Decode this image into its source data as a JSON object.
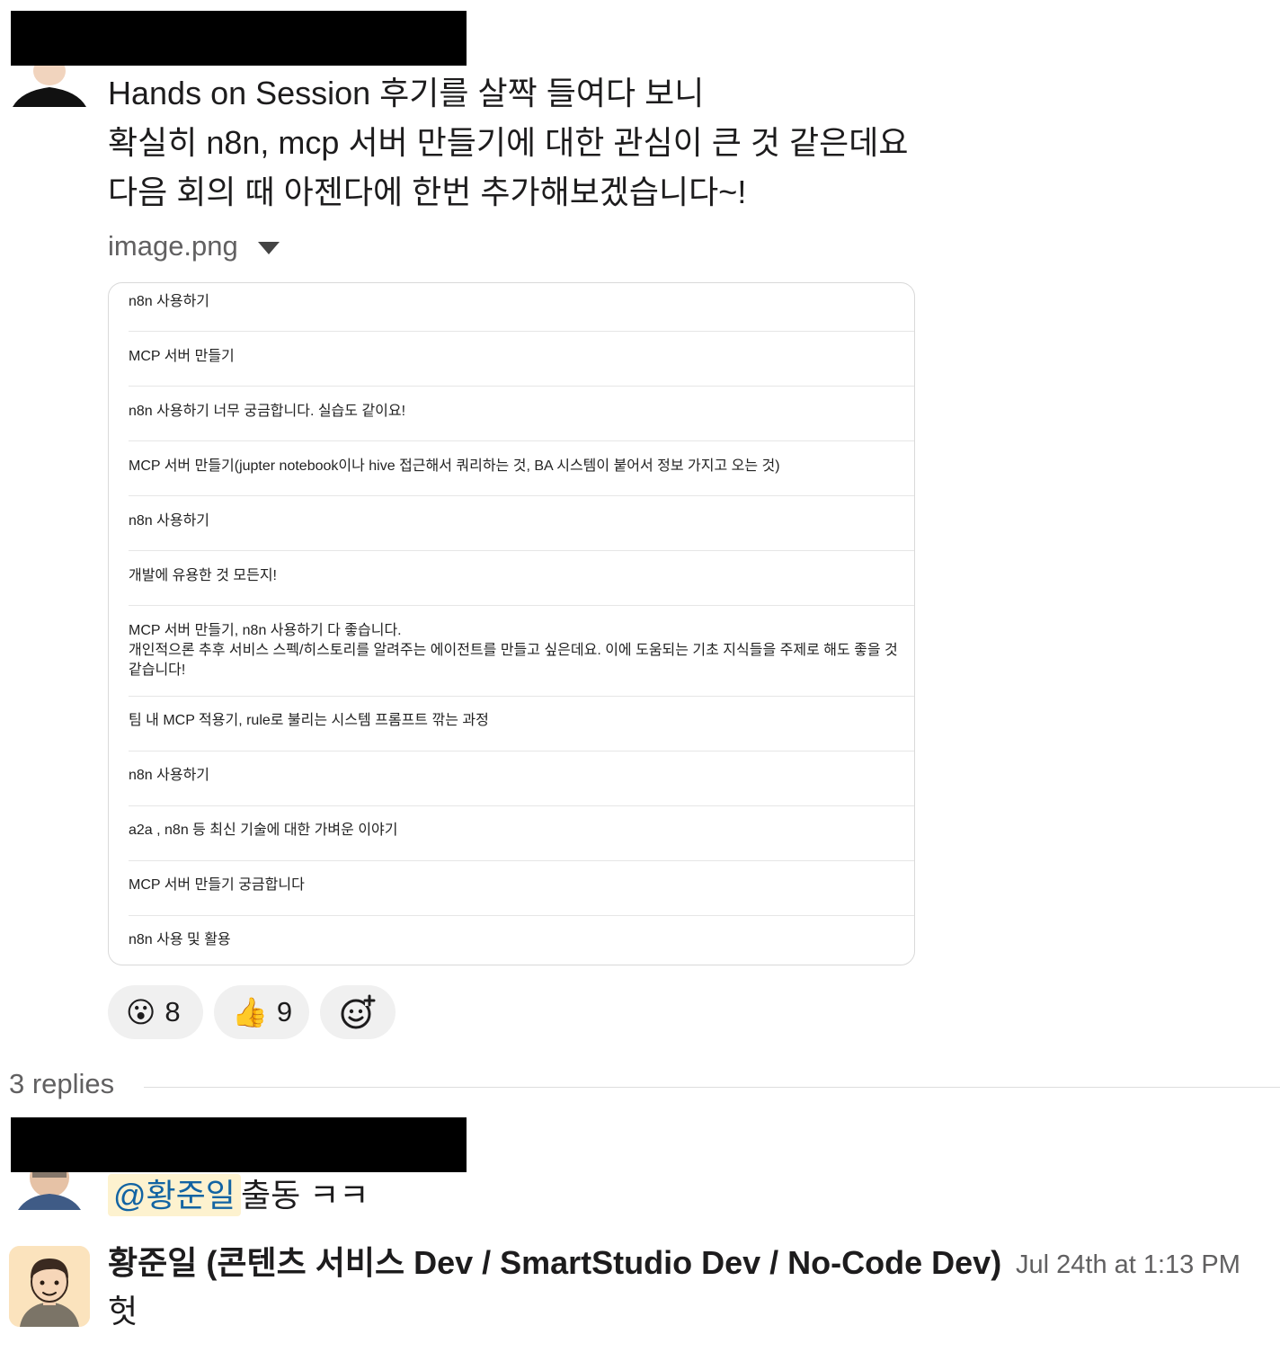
{
  "message": {
    "lines": [
      "Hands on Session 후기를 살짝 들여다 보니",
      "확실히 n8n, mcp 서버 만들기에 대한 관심이 큰 것 같은데요",
      "다음 회의 때 아젠다에 한번 추가해보겠습니다~!"
    ],
    "attachment_name": "image.png",
    "attachment_rows": [
      "n8n 사용하기",
      "MCP 서버 만들기",
      "n8n 사용하기 너무 궁금합니다. 실습도 같이요!",
      "MCP 서버 만들기(jupter notebook이나 hive 접근해서 쿼리하는 것, BA 시스템이 붙어서 정보 가지고 오는 것)",
      "n8n 사용하기",
      "개발에 유용한 것 모든지!",
      "MCP 서버 만들기, n8n 사용하기 다 좋습니다.\n개인적으론 추후 서비스 스펙/히스토리를 알려주는 에이전트를 만들고 싶은데요. 이에 도움되는 기초 지식들을 주제로 해도 좋을 것 같습니다!",
      "팀 내 MCP 적용기, rule로 불리는 시스템 프롬프트 깎는 과정",
      "n8n 사용하기",
      "a2a , n8n 등 최신 기술에 대한 가벼운 이야기",
      "MCP 서버 만들기 궁금합니다",
      "n8n 사용 및 활용"
    ],
    "reactions": [
      {
        "emoji": "😮",
        "count": "8"
      },
      {
        "emoji": "👍",
        "count": "9"
      }
    ]
  },
  "thread": {
    "replies_label": "3 replies",
    "reply1": {
      "mention": "@황준일",
      "text": "출동 ㅋㅋ"
    },
    "reply2": {
      "author": "황준일 (콘텐츠 서비스 Dev / SmartStudio Dev / No-Code Dev)",
      "timestamp": "Jul 24th at 1:13 PM",
      "text": "헛"
    }
  },
  "colors": {
    "mention_bg": "#fdf2cf",
    "mention_text": "#1264a3",
    "reaction_bg": "#f0f0f0"
  }
}
